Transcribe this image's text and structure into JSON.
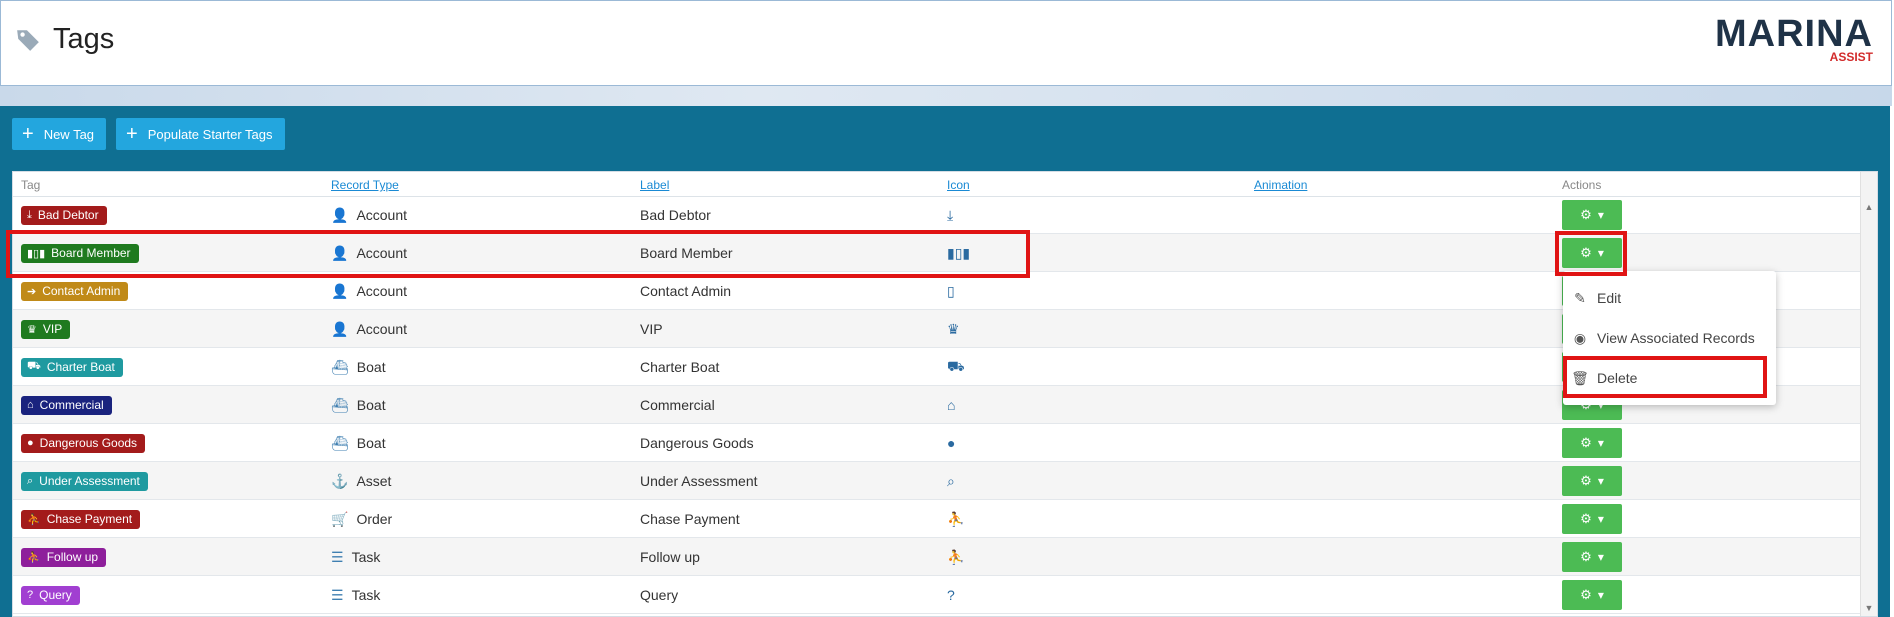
{
  "header": {
    "title": "Tags",
    "logo_main": "MARINA",
    "logo_sub": "ASSIST"
  },
  "toolbar": {
    "new_tag_label": "New Tag",
    "populate_label": "Populate Starter Tags"
  },
  "table": {
    "columns": {
      "tag": "Tag",
      "record_type": "Record Type",
      "label": "Label",
      "icon": "Icon",
      "animation": "Animation",
      "actions": "Actions"
    },
    "rows": [
      {
        "tag": "Bad Debtor",
        "color": "#a31b1b",
        "tag_icon": "hand-holding-dollar-icon",
        "record_type": "Account",
        "rt_icon": "user-icon",
        "label": "Bad Debtor",
        "icon": "hand-holding-dollar-icon"
      },
      {
        "tag": "Board Member",
        "color": "#1f7a1f",
        "tag_icon": "users-bars-icon",
        "record_type": "Account",
        "rt_icon": "user-icon",
        "label": "Board Member",
        "icon": "users-bars-icon"
      },
      {
        "tag": "Contact Admin",
        "color": "#c08a18",
        "tag_icon": "arrow-circle-icon",
        "record_type": "Account",
        "rt_icon": "user-icon",
        "label": "Contact Admin",
        "icon": "mobile-icon"
      },
      {
        "tag": "VIP",
        "color": "#1f7a1f",
        "tag_icon": "crown-icon",
        "record_type": "Account",
        "rt_icon": "user-icon",
        "label": "VIP",
        "icon": "crown-icon"
      },
      {
        "tag": "Charter Boat",
        "color": "#1f9aa0",
        "tag_icon": "truck-icon",
        "record_type": "Boat",
        "rt_icon": "ship-icon",
        "label": "Charter Boat",
        "icon": "truck-icon"
      },
      {
        "tag": "Commercial",
        "color": "#1a237e",
        "tag_icon": "warehouse-icon",
        "record_type": "Boat",
        "rt_icon": "ship-icon",
        "label": "Commercial",
        "icon": "warehouse-icon"
      },
      {
        "tag": "Dangerous Goods",
        "color": "#a31b1b",
        "tag_icon": "bomb-icon",
        "record_type": "Boat",
        "rt_icon": "ship-icon",
        "label": "Dangerous Goods",
        "icon": "bomb-icon"
      },
      {
        "tag": "Under Assessment",
        "color": "#1f9aa0",
        "tag_icon": "search-icon",
        "record_type": "Asset",
        "rt_icon": "anchor-icon",
        "label": "Under Assessment",
        "icon": "search-icon"
      },
      {
        "tag": "Chase Payment",
        "color": "#a31b1b",
        "tag_icon": "running-icon",
        "record_type": "Order",
        "rt_icon": "cart-icon",
        "label": "Chase Payment",
        "icon": "running-icon"
      },
      {
        "tag": "Follow up",
        "color": "#8e1f9b",
        "tag_icon": "running-icon",
        "record_type": "Task",
        "rt_icon": "tasks-icon",
        "label": "Follow up",
        "icon": "running-icon"
      },
      {
        "tag": "Query",
        "color": "#a13fd1",
        "tag_icon": "question-circle-icon",
        "record_type": "Task",
        "rt_icon": "tasks-icon",
        "label": "Query",
        "icon": "question-circle-icon"
      }
    ]
  },
  "dropdown": {
    "items": [
      {
        "label": "Edit",
        "icon": "edit-icon"
      },
      {
        "label": "View Associated Records",
        "icon": "eye-icon"
      },
      {
        "label": "Delete",
        "icon": "trash-icon"
      }
    ]
  },
  "colors": {
    "panel": "#0f6f92",
    "toolbar_button": "#23a6de",
    "action_button": "#4cbb54",
    "highlight": "#e01414",
    "link": "#1a8ad4"
  }
}
